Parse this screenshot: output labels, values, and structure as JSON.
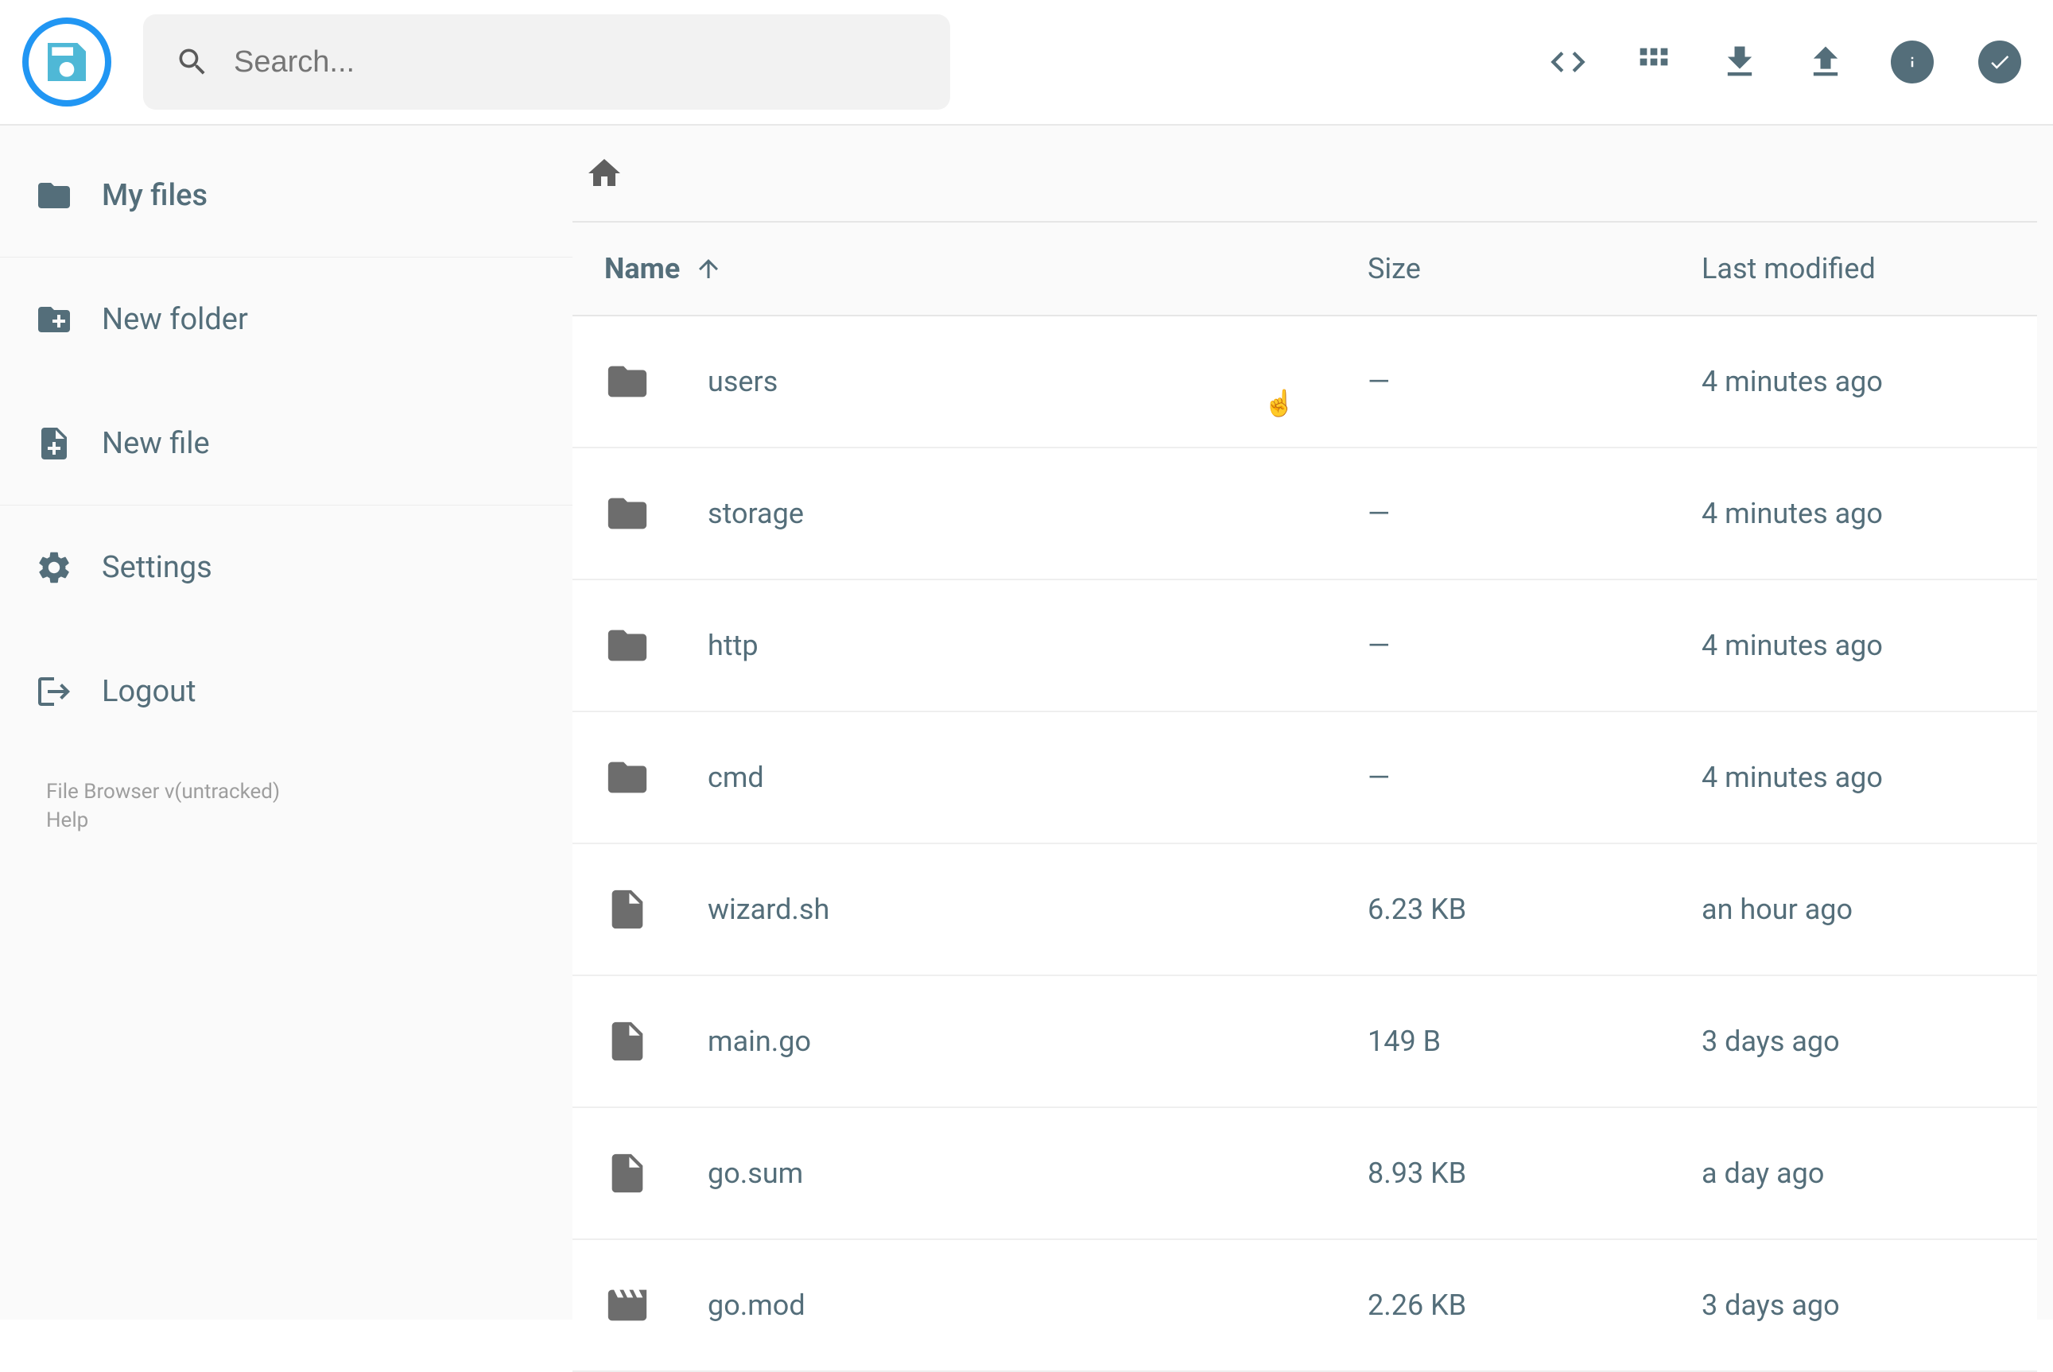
{
  "search": {
    "placeholder": "Search..."
  },
  "sidebar": {
    "items": [
      {
        "label": "My files"
      },
      {
        "label": "New folder"
      },
      {
        "label": "New file"
      },
      {
        "label": "Settings"
      },
      {
        "label": "Logout"
      }
    ],
    "footer_version": "File Browser v(untracked)",
    "footer_help": "Help"
  },
  "columns": {
    "name": "Name",
    "size": "Size",
    "modified": "Last modified"
  },
  "files": [
    {
      "name": "users",
      "size": "—",
      "modified": "4 minutes ago",
      "type": "folder"
    },
    {
      "name": "storage",
      "size": "—",
      "modified": "4 minutes ago",
      "type": "folder"
    },
    {
      "name": "http",
      "size": "—",
      "modified": "4 minutes ago",
      "type": "folder"
    },
    {
      "name": "cmd",
      "size": "—",
      "modified": "4 minutes ago",
      "type": "folder"
    },
    {
      "name": "wizard.sh",
      "size": "6.23 KB",
      "modified": "an hour ago",
      "type": "file"
    },
    {
      "name": "main.go",
      "size": "149 B",
      "modified": "3 days ago",
      "type": "file"
    },
    {
      "name": "go.sum",
      "size": "8.93 KB",
      "modified": "a day ago",
      "type": "file"
    },
    {
      "name": "go.mod",
      "size": "2.26 KB",
      "modified": "3 days ago",
      "type": "movie"
    }
  ]
}
